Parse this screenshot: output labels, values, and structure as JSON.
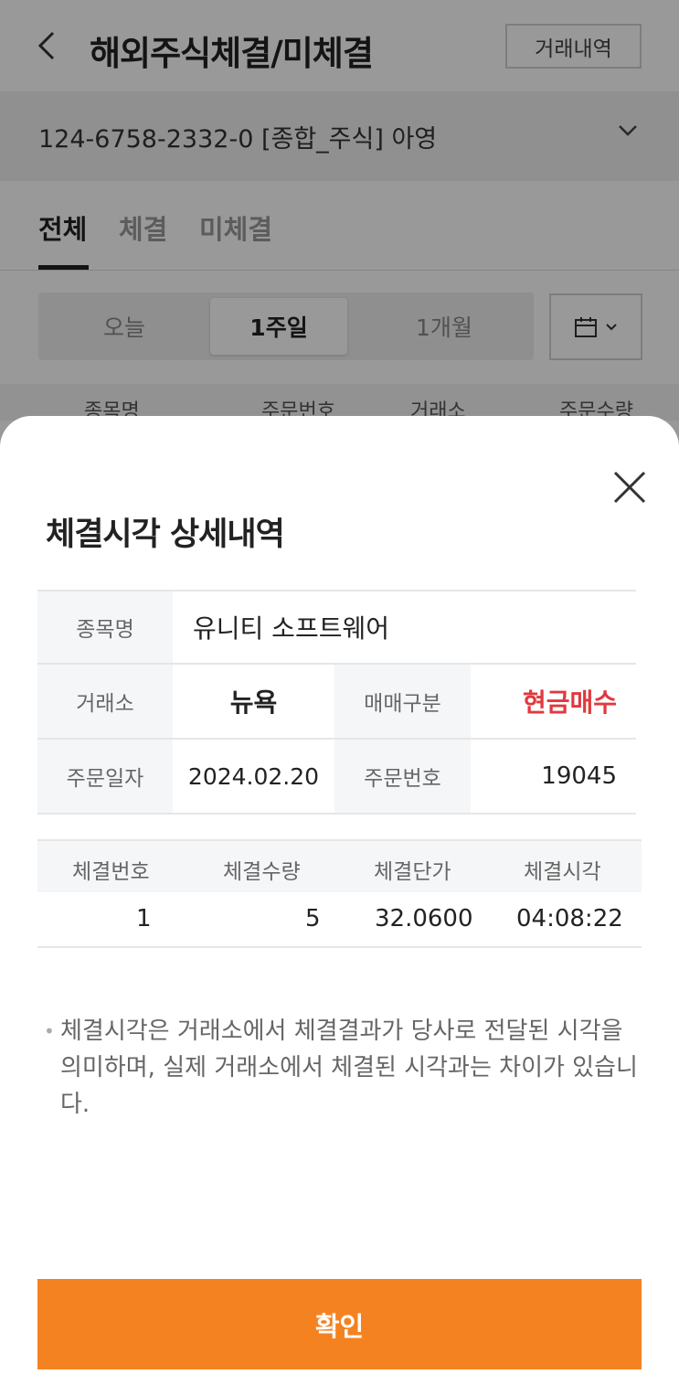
{
  "header": {
    "title": "해외주식체결/미체결",
    "history_button": "거래내역"
  },
  "account": {
    "text": "124-6758-2332-0 [종합_주식] 아영"
  },
  "tabs": [
    {
      "label": "전체",
      "active": true
    },
    {
      "label": "체결",
      "active": false
    },
    {
      "label": "미체결",
      "active": false
    }
  ],
  "period": {
    "options": [
      "오늘",
      "1주일",
      "1개월"
    ],
    "selected": "1주일"
  },
  "list_header": [
    "종목명",
    "주문번호",
    "거래소",
    "주문수량"
  ],
  "sheet": {
    "title": "체결시각 상세내역",
    "info": {
      "stock_label": "종목명",
      "stock_value": "유니티 소프트웨어",
      "exchange_label": "거래소",
      "exchange_value": "뉴욕",
      "trade_type_label": "매매구분",
      "trade_type_value": "현금매수",
      "order_date_label": "주문일자",
      "order_date_value": "2024.02.20",
      "order_no_label": "주문번호",
      "order_no_value": "19045"
    },
    "executions": {
      "columns": [
        "체결번호",
        "체결수량",
        "체결단가",
        "체결시각"
      ],
      "rows": [
        {
          "no": "1",
          "qty": "5",
          "price": "32.0600",
          "time": "04:08:22"
        }
      ]
    },
    "note": "체결시각은 거래소에서 체결결과가 당사로 전달된 시각을 의미하며, 실제 거래소에서 체결된 시각과는 차이가 있습니다.",
    "confirm_label": "확인"
  },
  "colors": {
    "accent": "#f58220",
    "buy_red": "#e0393e"
  }
}
